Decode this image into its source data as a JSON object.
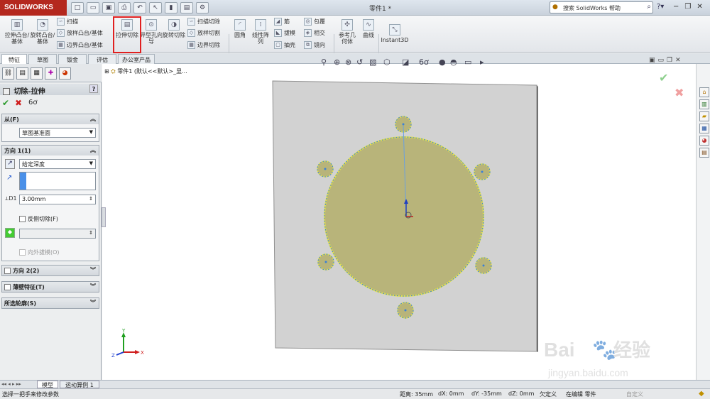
{
  "app": {
    "logo_text": "SOLIDWORKS",
    "document_title": "零件1 *"
  },
  "search": {
    "placeholder": "搜索 SolidWorks 帮助"
  },
  "ribbon": {
    "extrude_boss": "拉伸凸台/基体",
    "revolve_boss": "旋转凸台/基体",
    "sweep": "扫描",
    "loft_boss": "放样凸台/基体",
    "boundary_boss": "边界凸台/基体",
    "extrude_cut": "拉伸切除",
    "hole_wizard": "异型孔向导",
    "revolve_cut": "旋转切除",
    "swept_cut": "扫描切除",
    "lofted_cut": "放样切割",
    "boundary_cut": "边界切除",
    "fillet": "圆角",
    "linear_pattern": "线性阵列",
    "rib": "筋",
    "draft": "拔模",
    "shell": "抽壳",
    "wrap": "包覆",
    "intersect": "相交",
    "mirror": "镜向",
    "ref_geometry": "参考几何体",
    "curves": "曲线",
    "instant3d": "Instant3D"
  },
  "cmd_tabs": [
    "特征",
    "草图",
    "钣金",
    "评估",
    "办公室产品"
  ],
  "property_manager": {
    "title": "切除-拉伸",
    "help": "?",
    "from_label": "从(F)",
    "from_value": "草图基准面",
    "dir1_label": "方向 1(1)",
    "dir1_end": "给定深度",
    "depth_value": "3.00mm",
    "flip_side": "反侧切除(F)",
    "draft_outward": "向外拔模(O)",
    "dir2_label": "方向 2(2)",
    "thin_label": "薄壁特征(T)",
    "contours_label": "所选轮廓(S)"
  },
  "tree": {
    "root": "零件1 (默认<<默认>_显..."
  },
  "triad": {
    "x": "X",
    "y": "Y",
    "z": "Z"
  },
  "watermark": {
    "text1": "Bai",
    "text2": "经验",
    "url": "jingyan.baidu.com"
  },
  "bottom_tabs": [
    "模型",
    "运动算例 1"
  ],
  "status": {
    "hint": "选择一把手来修改参数",
    "distance": "距离: 35mm",
    "dx": "dX: 0mm",
    "dy": "dY: -35mm",
    "dz": "dZ: 0mm",
    "state": "欠定义",
    "editing": "在编辑 零件",
    "custom": "自定义"
  },
  "colors": {
    "highlight": "#e02020",
    "sketch_fill": "#b8b47a",
    "plate": "#d2d2d2",
    "accent": "#b4281e"
  }
}
